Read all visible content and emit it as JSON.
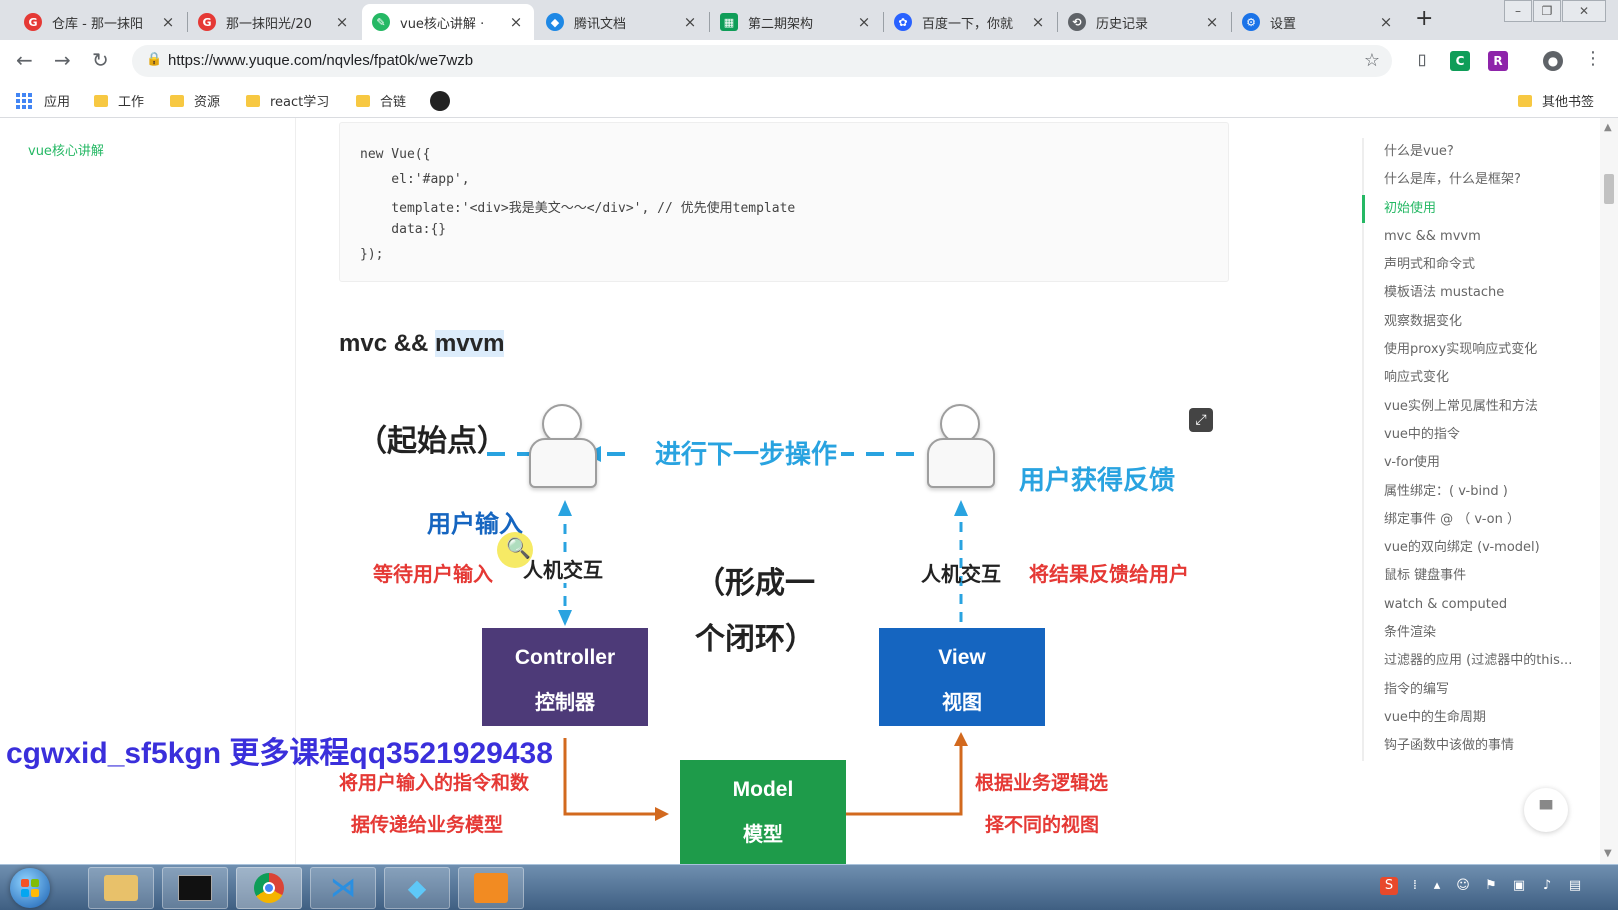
{
  "browser": {
    "tabs": [
      {
        "label": "仓库 - 那一抹阳",
        "favicon": "G",
        "color": "#e53935",
        "active": false
      },
      {
        "label": "那一抹阳光/20",
        "favicon": "G",
        "color": "#e53935",
        "active": false
      },
      {
        "label": "vue核心讲解 · ",
        "favicon": "✎",
        "color": "#25b864",
        "active": true
      },
      {
        "label": "腾讯文档",
        "favicon": "◆",
        "color": "#1e88e5",
        "active": false
      },
      {
        "label": "第二期架构",
        "favicon": "▦",
        "color": "#0f9d58",
        "active": false
      },
      {
        "label": "百度一下，你就",
        "favicon": "✿",
        "color": "#2962ff",
        "active": false
      },
      {
        "label": "历史记录",
        "favicon": "⟲",
        "color": "#5f6368",
        "active": false
      },
      {
        "label": "设置",
        "favicon": "⚙",
        "color": "#1a73e8",
        "active": false
      }
    ],
    "close_glyph": "×",
    "new_tab_glyph": "+",
    "url": "https://www.yuque.com/nqvles/fpat0k/we7wzb",
    "bookmarks": {
      "apps": "应用",
      "folders": [
        "工作",
        "资源",
        "react学习",
        "合链"
      ],
      "other": "其他书签"
    }
  },
  "sidebar": {
    "doc_link": "vue核心讲解"
  },
  "content": {
    "code_lines": [
      "new Vue({",
      "    el:'#app',",
      "    template:'<div>我是美文～～</div>', // 优先使用template",
      "    data:{}",
      "});"
    ],
    "heading_prefix": "mvc && ",
    "heading_highlight": "mvvm"
  },
  "diagram": {
    "start_point": "（起始点）",
    "next_step": "进行下一步操作",
    "user_feedback": "用户获得反馈",
    "user_input": "用户输入",
    "wait_input": "等待用户输入",
    "hci_left": "人机交互",
    "closed_loop_1": "（形成一",
    "closed_loop_2": "个闭环）",
    "hci_right": "人机交互",
    "feedback_result": "将结果反馈给用户",
    "controller_en": "Controller",
    "controller_cn": "控制器",
    "view_en": "View",
    "view_cn": "视图",
    "model_en": "Model",
    "model_cn": "模型",
    "pass_1": "将用户输入的指令和数",
    "pass_2": "据传递给业务模型",
    "select_1": "根据业务逻辑选",
    "select_2": "择不同的视图",
    "colors": {
      "controller": "#4d3a78",
      "view": "#1565c0",
      "model": "#1e9b4a",
      "arrow_blue": "#29a3e0",
      "arrow_orange": "#d2691e",
      "red_text": "#e53935"
    }
  },
  "toc": {
    "items": [
      "什么是vue?",
      "什么是库，什么是框架?",
      "初始使用",
      "mvc && mvvm",
      "声明式和命令式",
      "模板语法 mustache",
      "观察数据变化",
      "使用proxy实现响应式变化",
      "响应式变化",
      "vue实例上常见属性和方法",
      "vue中的指令",
      "v-for使用",
      "属性绑定：( v-bind )",
      "绑定事件 @ （ v-on ）",
      "vue的双向绑定 (v-model)",
      "鼠标 键盘事件",
      "watch & computed",
      "条件渲染",
      "过滤器的应用 (过滤器中的this...",
      "指令的编写",
      "vue中的生命周期",
      "钩子函数中该做的事情"
    ],
    "active_index": 2
  },
  "overlay": {
    "watermark": "cgwxid_sf5kgn 更多课程qq3521929438"
  }
}
